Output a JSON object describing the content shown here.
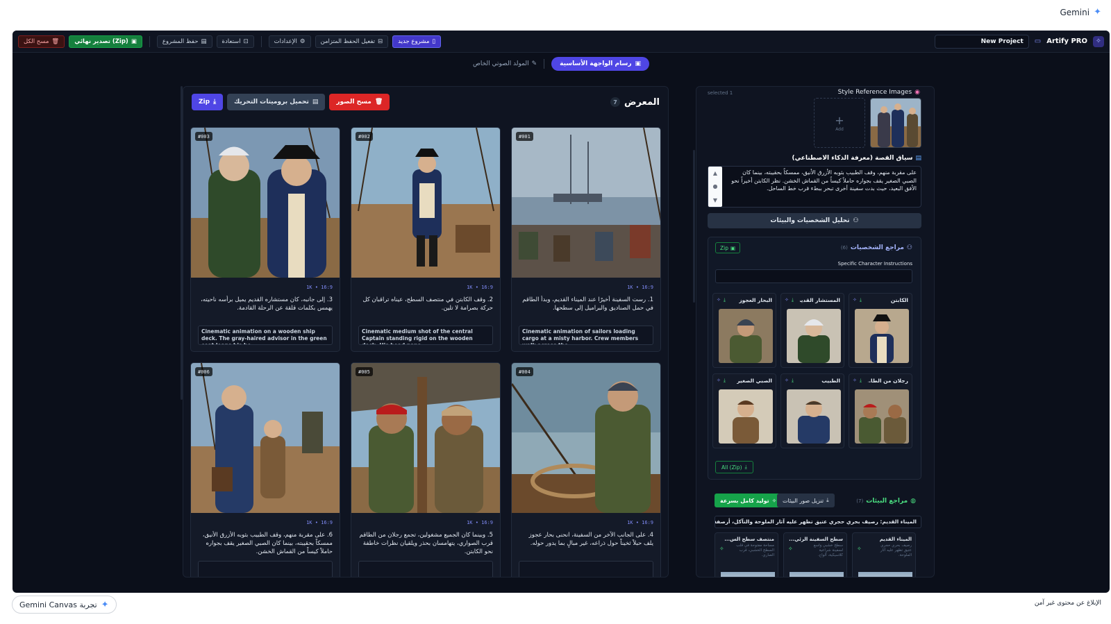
{
  "gemini": {
    "brand": "Gemini",
    "canvas_label": "Gemini Canvas تجربة",
    "report_text": "الإبلاغ عن محتوى غير آمن"
  },
  "toolbar": {
    "clear_all": "مسح الكل",
    "final_export": "تصدير نهائي (Zip)",
    "save_project": "حفظ المشروع",
    "restore": "استعادة",
    "settings": "الإعدادات",
    "sync_save": "تفعيل الحفظ المتزامن",
    "new_project": "مشروع جديد",
    "project_name": "New Project",
    "logo": "Artify PRO"
  },
  "modes": {
    "voice": "المولد الصوتي الخاص",
    "main": "رسام الواجهة الأساسية"
  },
  "gallery": {
    "title": "المعرض",
    "count": "7",
    "zip_label": "Zip",
    "download_prompts": "تحميل بروميتات التحريك",
    "clear_images": "مسح الصور",
    "cards": [
      {
        "id": "#003",
        "meta": "1K • 16:9",
        "text": "3. إلى جانبه، كان مستشاره القديم يميل برأسه ناحيته، يهمس بكلمات قلقة عن الرحلة القادمة.",
        "prompt": "Cinematic animation on a wooden ship deck. The gray-haired advisor in the green coat leans his he..."
      },
      {
        "id": "#002",
        "meta": "1K • 16:9",
        "text": "2. وقف الكابتن في منتصف السطح، عيناه تراقبان كل حركة بصرامة لا تلين.",
        "prompt": "Cinematic medium shot of the central Captain standing rigid on the wooden deck. His head pans..."
      },
      {
        "id": "#001",
        "meta": "1K • 16:9",
        "text": "1. رست السفينة أخيرًا عند الميناء القديم، وبدأ الطاقم في حمل الصناديق والبراميل إلى سطحها.",
        "prompt": "Cinematic animation of sailors loading cargo at a misty harbor. Crew members walk across the..."
      },
      {
        "id": "#006",
        "meta": "1K • 16:9",
        "text": "6. على مقربة منهم، وقف الطبيب بثوبه الأزرق الأنيق، ممسكاً بحقيبته، بينما كان الصبي الصغير يقف بجواره حاملاً كيساً من القماش الخشن.",
        "prompt": ""
      },
      {
        "id": "#005",
        "meta": "1K • 16:9",
        "text": "5. وبينما كان الجميع مشغولين، تجمع رجلان من الطاقم قرب الصواري، يتهامسان بحذر ويلقيان نظرات خاطفة نحو الكابتن.",
        "prompt": ""
      },
      {
        "id": "#004",
        "meta": "1K • 16:9",
        "text": "4. على الجانب الآخر من السفينة، انحنى بحار عجوز يلف حبلاً ثخيناً حول ذراعه، غير مبالٍ بما يدور حوله.",
        "prompt": ""
      }
    ]
  },
  "references": {
    "title": "Style Reference Images",
    "selected": "selected 1",
    "add": "Add"
  },
  "story": {
    "title": "سياق القصة (معرفة الذكاء الاصطناعي)",
    "text": "على مقربة منهم، وقف الطبيب بثوبه الأزرق الأنيق، ممسكاً بحقيبته، بينما كان الصبي الصغير يقف بجواره حاملاً كيساً من القماش الخشن. نظر الكابتن أخيراً نحو الأفق البعيد، حيث بدت سفينة أخرى تبحر ببطء قرب خط الساحل."
  },
  "analyze_button": "تحليل الشخصيات والبيئات",
  "characters": {
    "title": "مراجع الشخصيات",
    "count": "(6)",
    "zip": "Zip",
    "instructions_label": "Specific Character Instructions",
    "all_zip": "All (Zip)",
    "items": [
      {
        "name": "الكابتن"
      },
      {
        "name": "المستشار القديم"
      },
      {
        "name": "البحار العجوز"
      },
      {
        "name": "رجلان من الطا..."
      },
      {
        "name": "الطبيب"
      },
      {
        "name": "الصبي الصغير"
      }
    ]
  },
  "environments": {
    "title": "مراجع البيئات",
    "count": "(7)",
    "download": "تنزيل صور البيئات",
    "generate": "توليد كامل بسرعة",
    "input_value": "الميناء القديم: رصيف بحري حجري عتيق تظهر عليه آثار الملوحة والتآكل، أرصفة خشبية متهالكة.",
    "items": [
      {
        "name": "الميناء القديم",
        "desc": "رصيف بحري حجري عتيق تظهر عليه آثار الملوحة."
      },
      {
        "name": "سطح السفينة الرئي...",
        "desc": "سطح خشبي واسع لسفينة شراعية كلاسيكية، ألواح."
      },
      {
        "name": "منتصف سطح الس...",
        "desc": "مساحة مفتوحة في قلب السطح الخشبي، قرب الصاري."
      }
    ]
  }
}
